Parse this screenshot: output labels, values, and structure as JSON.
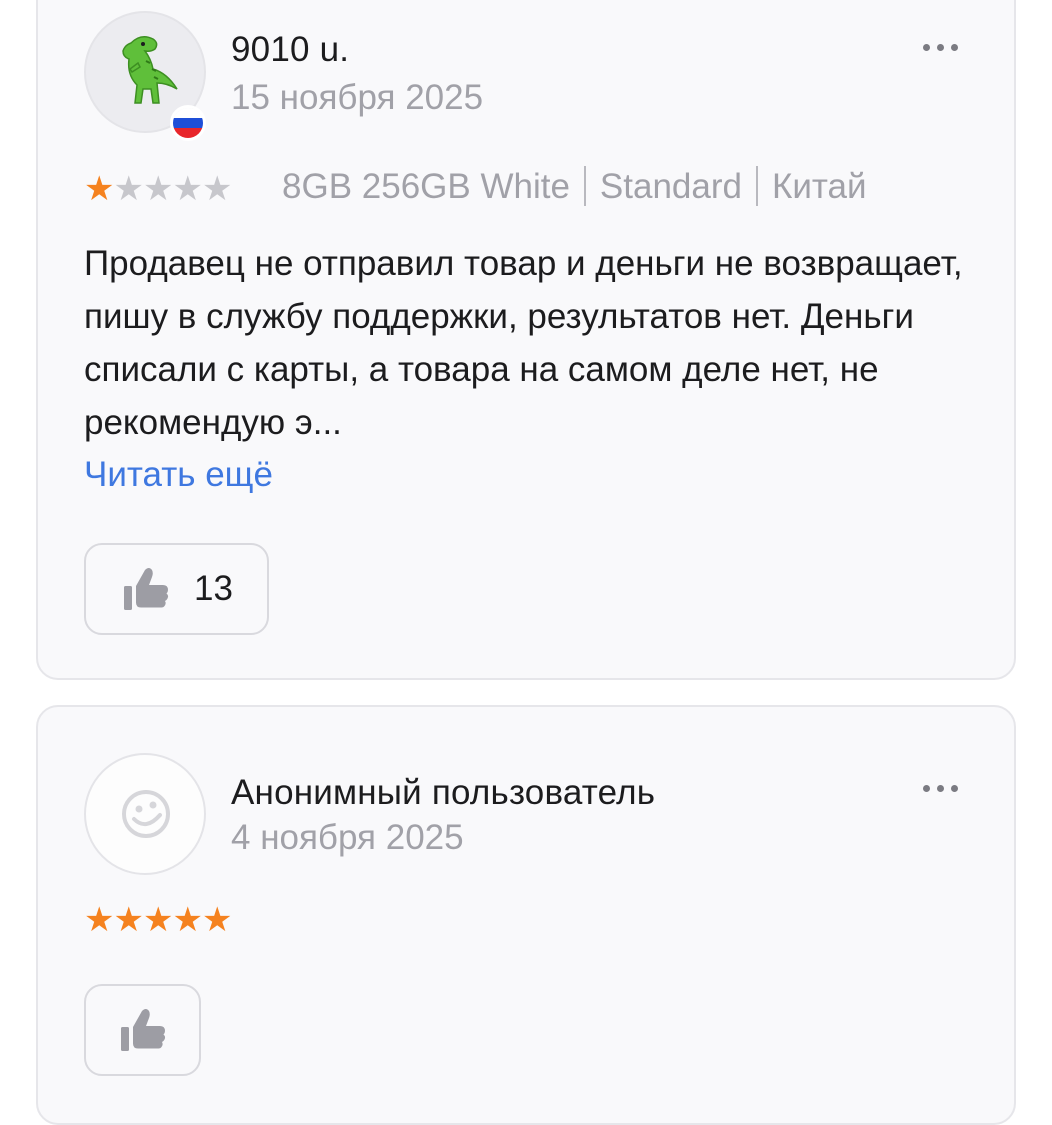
{
  "reviews": [
    {
      "author": "9010 u.",
      "date": "15 ноября 2025",
      "rating": 1,
      "max_rating": 5,
      "avatar_icon": "dinosaur-emoji-icon",
      "country_flag_icon": "russia-flag-icon",
      "variant": {
        "config": "8GB 256GB White",
        "edition": "Standard",
        "region": "Китай"
      },
      "text": "Продавец не отправил товар и деньги не возвращает, пишу в службу поддержки, результатов нет. Деньги списали с карты, а товара на самом деле нет, не рекомендую э...",
      "read_more_label": "Читать ещё",
      "likes": "13"
    },
    {
      "author": "Анонимный пользователь",
      "date": "4 ноября 2025",
      "rating": 5,
      "max_rating": 5,
      "avatar_icon": "smiley-placeholder-icon",
      "likes": ""
    }
  ],
  "colors": {
    "star_active": "#f5821f",
    "star_inactive": "#c7c7cc",
    "link": "#3f78e0",
    "muted_text": "#a1a1a8"
  },
  "glyphs": {
    "star": "★"
  }
}
